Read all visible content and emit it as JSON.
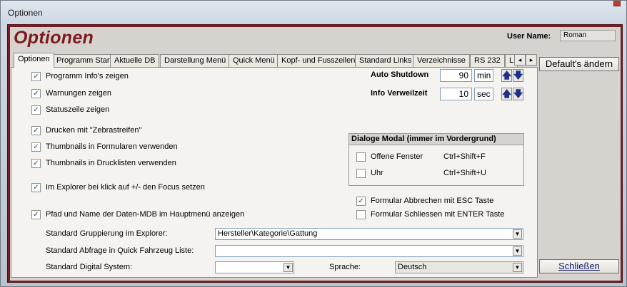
{
  "window": {
    "title": "Optionen"
  },
  "header": {
    "app_title": "Optionen",
    "user_label": "User Name:",
    "user_value": "Roman"
  },
  "tabs": [
    {
      "label": "Optionen"
    },
    {
      "label": "Programm Start"
    },
    {
      "label": "Aktuelle DB"
    },
    {
      "label": "Darstellung Menü"
    },
    {
      "label": "Quick Menü"
    },
    {
      "label": "Kopf- und Fusszeilen"
    },
    {
      "label": "Standard Links"
    },
    {
      "label": "Verzeichnisse"
    },
    {
      "label": "RS 232"
    },
    {
      "label": "L"
    }
  ],
  "checkboxes": [
    {
      "label": "Programm Info's zeigen",
      "checked": true
    },
    {
      "label": "Warnungen zeigen",
      "checked": true
    },
    {
      "label": "Statuszeile zeigen",
      "checked": true
    },
    {
      "label": "Drucken mit \"Zebrastreifen\"",
      "checked": true
    },
    {
      "label": "Thumbnails in Formularen verwenden",
      "checked": true
    },
    {
      "label": "Thumbnails in Drucklisten verwenden",
      "checked": true
    },
    {
      "label": "Im Explorer bei klick auf +/- den Focus setzen",
      "checked": true
    },
    {
      "label": "Pfad und Name der Daten-MDB im Hauptmenü anzeigen",
      "checked": true
    }
  ],
  "auto_shutdown": {
    "label": "Auto Shutdown",
    "value": "90",
    "unit": "min"
  },
  "info_delay": {
    "label": "Info Verweilzeit",
    "value": "10",
    "unit": "sec"
  },
  "dialog_modal": {
    "header": "Dialoge Modal (immer im Vordergrund)",
    "items": [
      {
        "label": "Offene Fenster",
        "shortcut": "Ctrl+Shift+F",
        "checked": false
      },
      {
        "label": "Uhr",
        "shortcut": "Ctrl+Shift+U",
        "checked": false
      }
    ]
  },
  "right_checks": [
    {
      "label": "Formular Abbrechen mit ESC Taste",
      "checked": true
    },
    {
      "label": "Formular Schliessen mit ENTER Taste",
      "checked": false
    }
  ],
  "fields": {
    "grouping_label": "Standard Gruppierung im Explorer:",
    "grouping_value": "Hersteller\\Kategorie\\Gattung",
    "query_label": "Standard Abfrage in Quick Fahrzeug Liste:",
    "query_value": "",
    "digital_label": "Standard Digital System:",
    "digital_value": "",
    "language_label": "Sprache:",
    "language_value": "Deutsch"
  },
  "buttons": {
    "default": "Default's ändern",
    "close": "Schließen"
  },
  "icons": {
    "check": "✓",
    "up": "🡅",
    "down": "🡇",
    "combo": "▼",
    "tab_left": "◂",
    "tab_right": "▸"
  },
  "colors": {
    "accent": "#7c1a1f",
    "title": "#7c1a1f"
  }
}
